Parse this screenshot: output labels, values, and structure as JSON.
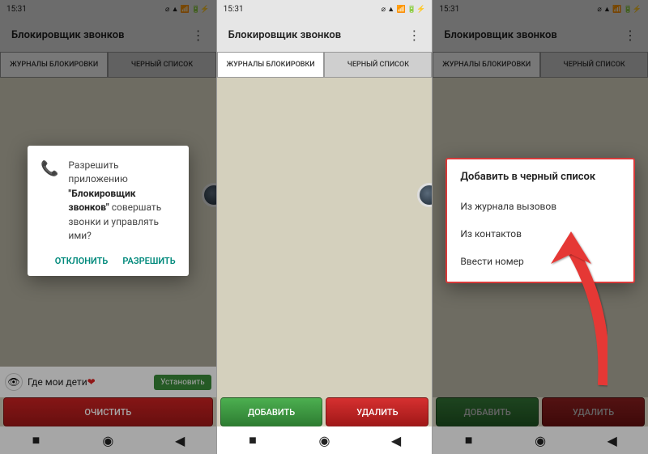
{
  "status_time": "15:31",
  "app_title": "Блокировщик звонков",
  "tabs": {
    "logs": "ЖУРНАЛЫ БЛОКИРОВКИ",
    "blacklist": "ЧЕРНЫЙ СПИСОК"
  },
  "buttons": {
    "clear": "ОЧИСТИТЬ",
    "add": "ДОБАВИТЬ",
    "delete": "УДАЛИТЬ"
  },
  "ad": {
    "text": "Где мои дети",
    "install": "Установить"
  },
  "permission": {
    "line1": "Разрешить приложению ",
    "bold": "\"Блокировщик звонков\"",
    "line2": " совершать звонки и управлять ими?",
    "deny": "ОТКЛОНИТЬ",
    "allow": "РАЗРЕШИТЬ"
  },
  "menu": {
    "title": "Добавить в черный список",
    "from_log": "Из журнала вызовов",
    "from_contacts": "Из контактов",
    "enter_number": "Ввести номер"
  }
}
